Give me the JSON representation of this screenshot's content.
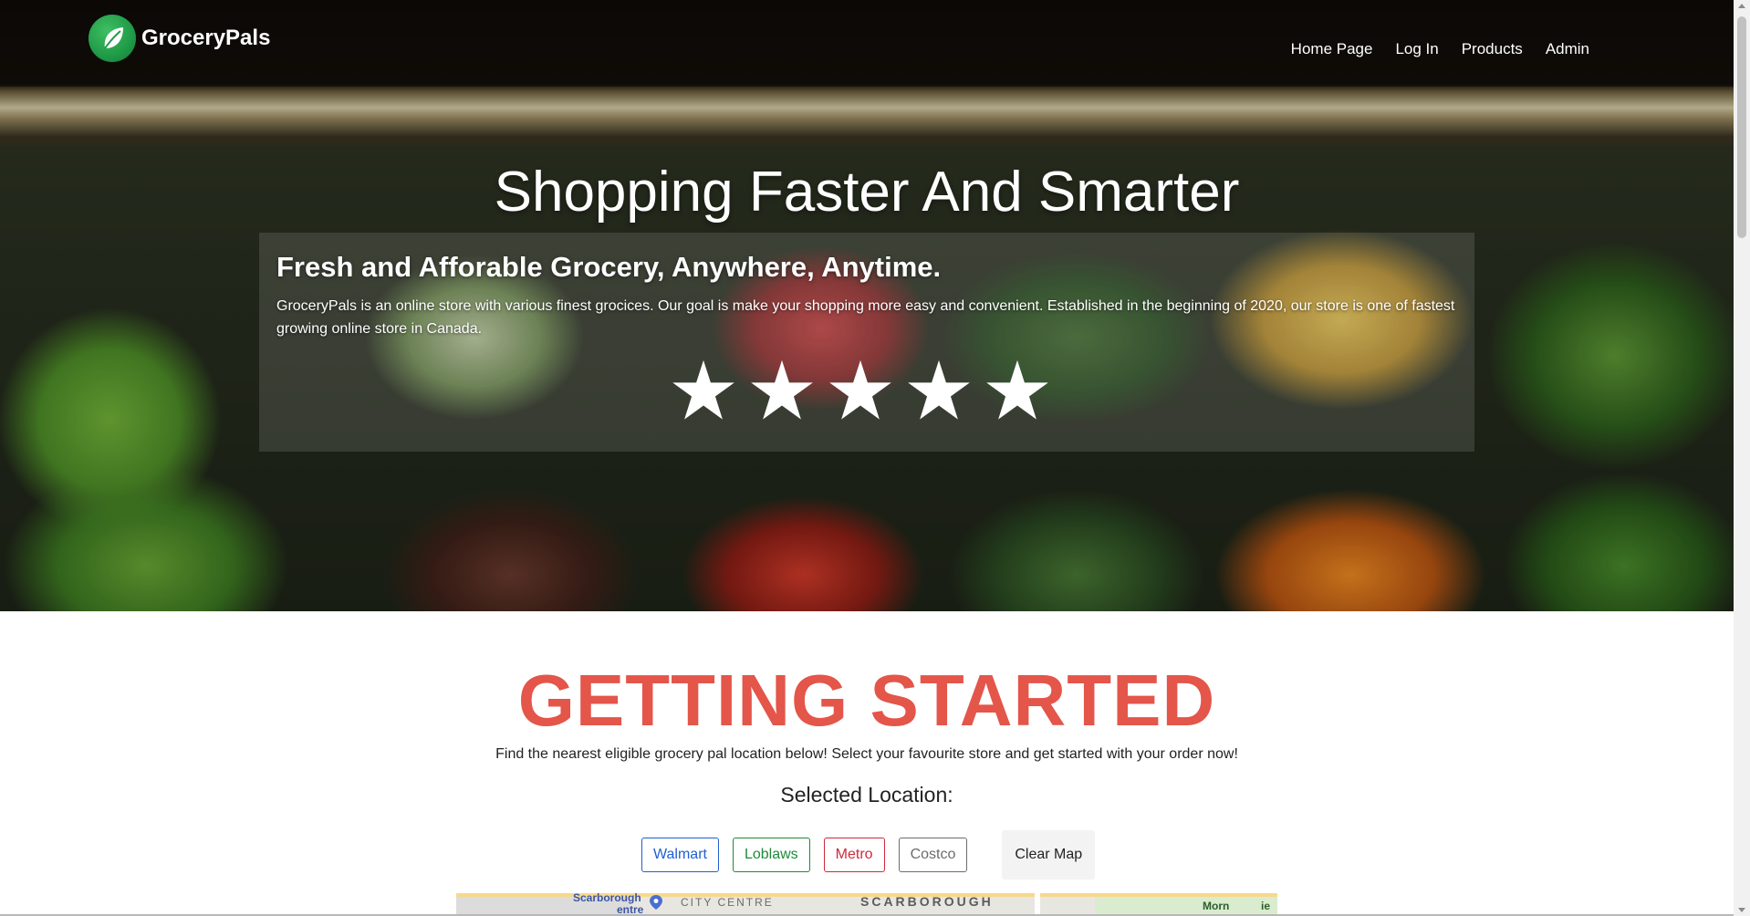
{
  "nav": {
    "brand": "GroceryPals",
    "links": [
      "Home Page",
      "Log In",
      "Products",
      "Admin"
    ]
  },
  "hero": {
    "title": "Shopping Faster And Smarter",
    "subtitle": "Fresh and Afforable Grocery, Anywhere, Anytime.",
    "description": "GroceryPals is an online store with various finest grocices. Our goal is make your shopping more easy and convenient. Established in the beginning of 2020, our store is one of fastest growing online store in Canada.",
    "rating": 5,
    "rating_max": 5
  },
  "getting_started": {
    "title": "GETTING STARTED",
    "description": "Find the nearest eligible grocery pal location below! Select your favourite store and get started with your order now!",
    "selected_location_label": "Selected Location:"
  },
  "store_buttons": [
    {
      "label": "Walmart",
      "color": "#1f5fd1"
    },
    {
      "label": "Loblaws",
      "color": "#1e8a3a"
    },
    {
      "label": "Metro",
      "color": "#d1283a"
    },
    {
      "label": "Costco",
      "color": "#6c6c6c"
    }
  ],
  "clear_button": "Clear Map",
  "map": {
    "place_1": "Scarborough",
    "place_1b": "entre",
    "place_2": "CITY CENTRE",
    "place_3": "SCARBOROUGH",
    "place_4": "Morn",
    "place_4b": "ie"
  },
  "colors": {
    "accent_red": "#e4554a",
    "brand_green": "#1f9a47"
  }
}
